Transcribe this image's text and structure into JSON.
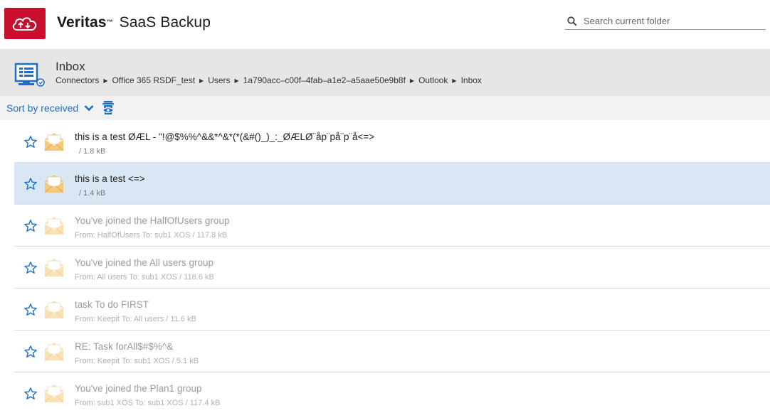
{
  "app": {
    "brand": "Veritas",
    "tm": "™",
    "product": "SaaS Backup"
  },
  "search": {
    "placeholder": "Search current folder"
  },
  "folder": {
    "title": "Inbox",
    "breadcrumb": [
      "Connectors",
      "Office 365 RSDF_test",
      "Users",
      "1a790acc–c00f–4fab–a1e2–a5aae50e9b8f",
      "Outlook",
      "Inbox"
    ]
  },
  "sort": {
    "label": "Sort by received"
  },
  "colors": {
    "brand_red": "#c8102e",
    "link_blue": "#1f6fc5",
    "selected_row": "#d8e7f3",
    "folder_bar": "#e6e6e6"
  },
  "messages": [
    {
      "subject": "this is a test ØÆL - \"!@$%%^&&*^&*(*(&#()_)_:_ØÆLØ¨åp¨på¨p¨å<=>",
      "meta": "/ 1.8 kB",
      "read": false,
      "selected": false
    },
    {
      "subject": "this is a test <=>",
      "meta": "/ 1.4 kB",
      "read": false,
      "selected": true
    },
    {
      "subject": "You've joined the HalfOfUsers group",
      "meta": "From: HalfOfUsers  To: sub1 XOS / 117.8 kB",
      "read": true,
      "selected": false
    },
    {
      "subject": "You've joined the All users group",
      "meta": "From: All users  To: sub1 XOS / 118.6 kB",
      "read": true,
      "selected": false
    },
    {
      "subject": "task To do FIRST",
      "meta": "From: Keepit  To: All users / 11.6 kB",
      "read": true,
      "selected": false
    },
    {
      "subject": "RE: Task forAll$#$%^&",
      "meta": "From: Keepit  To: sub1 XOS / 5.1 kB",
      "read": true,
      "selected": false
    },
    {
      "subject": "You've joined the Plan1 group",
      "meta": "From: sub1 XOS  To: sub1 XOS / 117.4 kB",
      "read": true,
      "selected": false
    }
  ]
}
